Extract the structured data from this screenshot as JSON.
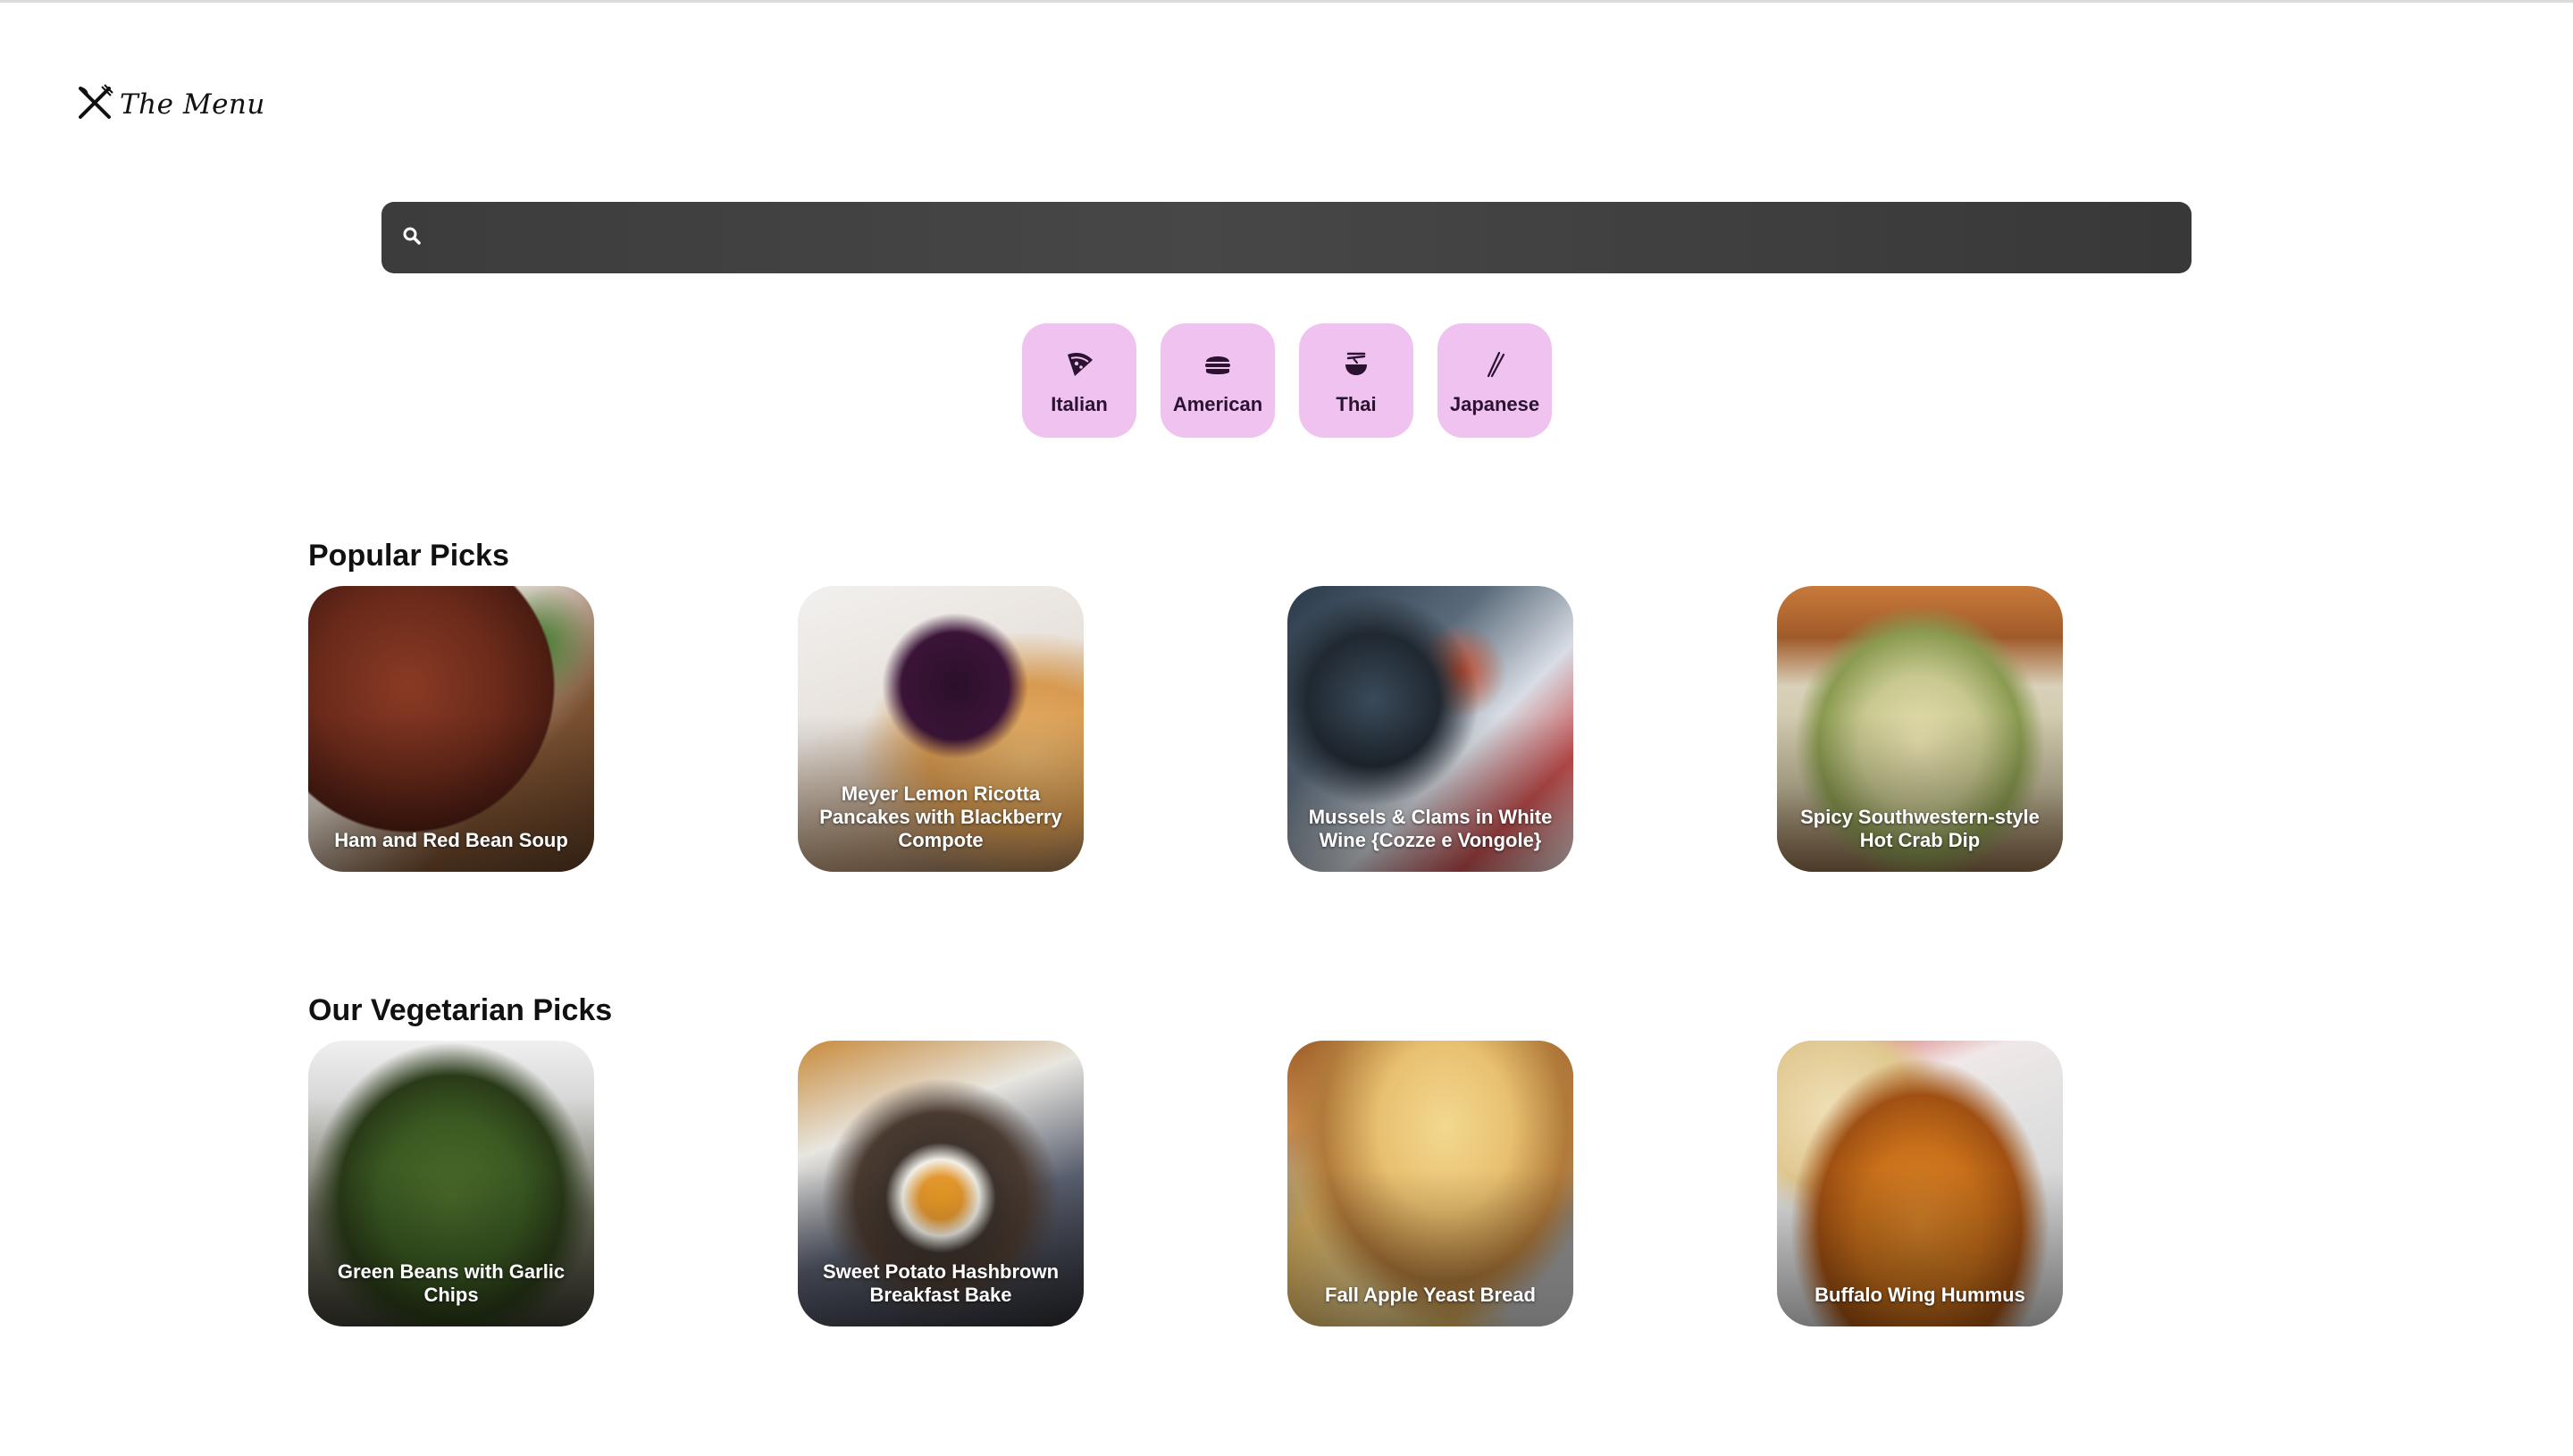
{
  "brand": {
    "name": "The Menu",
    "icon": "fork-knife-icon"
  },
  "search": {
    "placeholder": "",
    "value": "",
    "icon": "search-icon"
  },
  "cuisines": [
    {
      "label": "Italian",
      "icon": "pizza-icon"
    },
    {
      "label": "American",
      "icon": "burger-icon"
    },
    {
      "label": "Thai",
      "icon": "noodle-bowl-icon"
    },
    {
      "label": "Japanese",
      "icon": "chopsticks-icon"
    }
  ],
  "colors": {
    "cuisine_bg": "#f0c2f0",
    "search_bg": "#3f3f3f"
  },
  "sections": [
    {
      "title": "Popular Picks",
      "items": [
        {
          "title": "Ham and Red Bean Soup"
        },
        {
          "title": "Meyer Lemon Ricotta Pancakes with Blackberry Compote"
        },
        {
          "title": "Mussels & Clams in White Wine {Cozze e Vongole}"
        },
        {
          "title": "Spicy Southwestern-style Hot Crab Dip"
        }
      ]
    },
    {
      "title": "Our Vegetarian Picks",
      "items": [
        {
          "title": "Green Beans with Garlic Chips"
        },
        {
          "title": "Sweet Potato Hashbrown Breakfast Bake"
        },
        {
          "title": "Fall Apple Yeast Bread"
        },
        {
          "title": "Buffalo Wing Hummus"
        }
      ]
    }
  ]
}
